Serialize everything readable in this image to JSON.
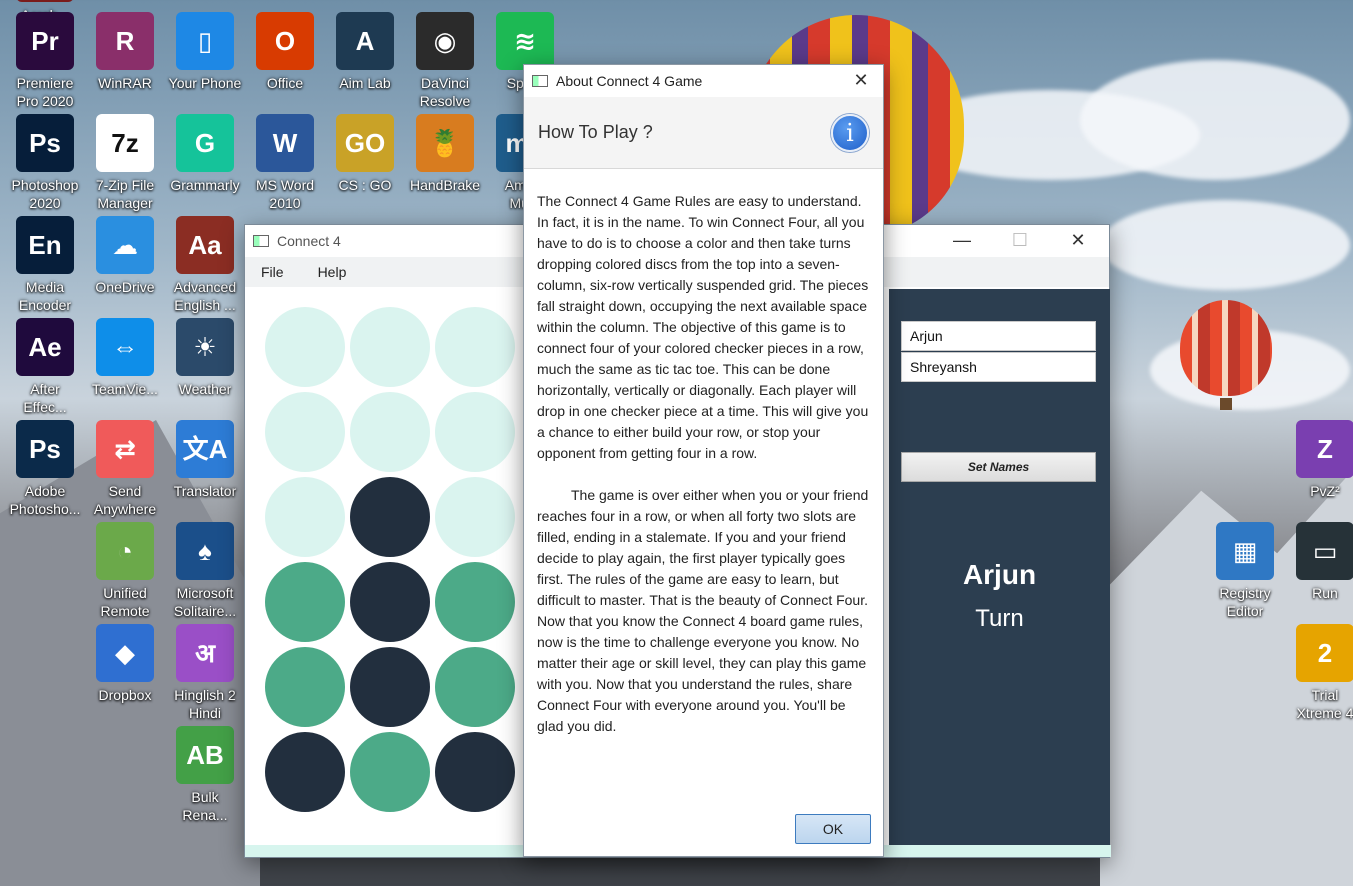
{
  "desktop": {
    "icons": [
      {
        "label": "Acrob...",
        "glyph": "",
        "color": "#7a1c1c"
      },
      {
        "label": "Premiere\nPro 2020",
        "glyph": "Pr",
        "color": "#2a0a3d"
      },
      {
        "label": "WinRAR",
        "glyph": "R",
        "color": "#8a2f6a"
      },
      {
        "label": "Your Phone",
        "glyph": "▯",
        "color": "#1e88e5"
      },
      {
        "label": "Office",
        "glyph": "O",
        "color": "#d83b01"
      },
      {
        "label": "Aim Lab",
        "glyph": "A",
        "color": "#1e3a52"
      },
      {
        "label": "DaVinci\nResolve",
        "glyph": "◉",
        "color": "#2b2b2b"
      },
      {
        "label": "Spo...",
        "glyph": "≋",
        "color": "#1db954"
      },
      {
        "label": "Photoshop\n2020",
        "glyph": "Ps",
        "color": "#061e3a"
      },
      {
        "label": "7-Zip File\nManager",
        "glyph": "7z",
        "color": "#ffffff"
      },
      {
        "label": "Grammarly",
        "glyph": "G",
        "color": "#15c39a"
      },
      {
        "label": "MS Word\n2010",
        "glyph": "W",
        "color": "#2b579a"
      },
      {
        "label": "CS : GO",
        "glyph": "GO",
        "color": "#c9a227"
      },
      {
        "label": "HandBrake",
        "glyph": "🍍",
        "color": "#d87c1f"
      },
      {
        "label": "Ama...\nMu...",
        "glyph": "mu",
        "color": "#1f5d8c"
      },
      {
        "label": "Media\nEncoder",
        "glyph": "En",
        "color": "#061e3a"
      },
      {
        "label": "OneDrive",
        "glyph": "☁",
        "color": "#2a8fe0"
      },
      {
        "label": "Advanced\nEnglish ...",
        "glyph": "Aa",
        "color": "#8b2d23"
      },
      {
        "label": "After\nEffec...",
        "glyph": "Ae",
        "color": "#1f0a3d"
      },
      {
        "label": "TeamVie...",
        "glyph": "⇔",
        "color": "#0e8ee9"
      },
      {
        "label": "Weather",
        "glyph": "☀",
        "color": "#2b4a6a"
      },
      {
        "label": "Adobe\nPhotosho...",
        "glyph": "Ps",
        "color": "#0b2a4a"
      },
      {
        "label": "Send\nAnywhere",
        "glyph": "⇄",
        "color": "#f05a5a"
      },
      {
        "label": "Translator",
        "glyph": "文A",
        "color": "#2d7cd6"
      },
      {
        "label": "Unified\nRemote",
        "glyph": "◔",
        "color": "#6ba94a"
      },
      {
        "label": "Microsoft\nSolitaire...",
        "glyph": "♠",
        "color": "#1b4f8a"
      },
      {
        "label": "Dropbox",
        "glyph": "◆",
        "color": "#2f6fd1"
      },
      {
        "label": "Hinglish 2\nHindi",
        "glyph": "अ",
        "color": "#9a4fc7"
      },
      {
        "label": "Bulk\nRena...",
        "glyph": "AB",
        "color": "#43a047"
      },
      {
        "label": "PvZ²",
        "glyph": "Z",
        "color": "#7a3fb0"
      },
      {
        "label": "Registry\nEditor",
        "glyph": "▦",
        "color": "#2f78c4"
      },
      {
        "label": "Run",
        "glyph": "▭",
        "color": "#263238"
      },
      {
        "label": "Trial\nXtreme 4",
        "glyph": "2",
        "color": "#e6a400"
      }
    ]
  },
  "connect4": {
    "title": "Connect 4",
    "menu": [
      "File",
      "Help"
    ],
    "colors": {
      "empty": "#daf4ef",
      "player1": "#4caa88",
      "player2": "#222f3e",
      "panel": "#2c3e50"
    },
    "board": {
      "columns_visible": 3,
      "rows": [
        [
          "empty",
          "empty",
          "empty"
        ],
        [
          "empty",
          "empty",
          "empty"
        ],
        [
          "empty",
          "player2",
          "empty"
        ],
        [
          "player1",
          "player2",
          "player1"
        ],
        [
          "player1",
          "player2",
          "player1"
        ],
        [
          "player2",
          "player1",
          "player2"
        ]
      ]
    },
    "player_one_name": "Arjun",
    "player_two_name": "Shreyansh",
    "set_names_label": "Set Names",
    "turn_player": "Arjun",
    "turn_label": "Turn"
  },
  "about_dialog": {
    "title": "About Connect 4 Game",
    "header": "How To Play ?",
    "info_glyph": "i",
    "paragraph1": "The Connect 4 Game Rules are easy to understand. In fact, it is in the name. To win Connect Four, all you have to do is to choose a color and then take turns dropping colored discs from the top into a seven-column, six-row vertically suspended grid. The pieces fall straight down, occupying the next available space within the column. The objective of this game is to connect four of your colored checker pieces in a row, much the same as tic tac toe. This can be done horizontally, vertically or diagonally. Each player will drop in one checker piece at a time. This will give you a chance to either build your row, or stop your opponent from getting four in a row.",
    "paragraph2": "The game is over either when you or your friend reaches four in a row, or when all forty two slots are filled, ending in a stalemate. If you and your friend decide to play again, the first player typically goes first. The rules of the game are easy to learn, but difficult to master. That is the beauty of Connect Four. Now that you know the Connect 4 board game rules, now is the time to challenge everyone you know. No matter their age or skill level, they can play this game with you. Now that you understand the rules, share Connect Four with everyone around you. You'll be glad you did.",
    "ok_label": "OK"
  },
  "window_controls": {
    "minimize": "—",
    "maximize": "☐",
    "close": "✕"
  }
}
